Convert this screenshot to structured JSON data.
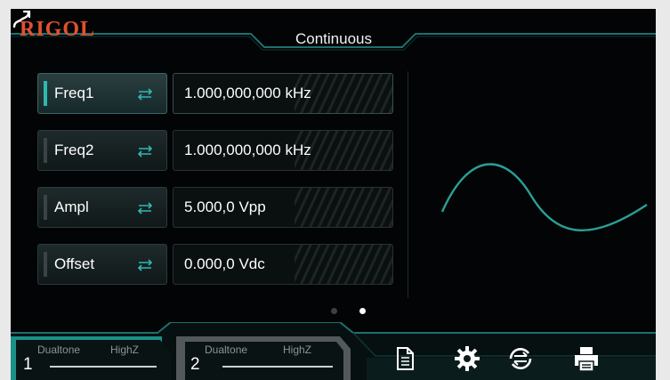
{
  "header": {
    "brand": "RIGOL",
    "mode": "Continuous",
    "status_icon": "network-link-icon"
  },
  "params": [
    {
      "label": "Freq1",
      "value": "1.000,000,000 kHz",
      "active": true
    },
    {
      "label": "Freq2",
      "value": "1.000,000,000 kHz",
      "active": false
    },
    {
      "label": "Ampl",
      "value": "5.000,0 Vpp",
      "active": false
    },
    {
      "label": "Offset",
      "value": "0.000,0 Vdc",
      "active": false
    }
  ],
  "pager": {
    "pages": 2,
    "current": 2
  },
  "channels": [
    {
      "number": "1",
      "mode": "Dualtone",
      "load": "HighZ"
    },
    {
      "number": "2",
      "mode": "Dualtone",
      "load": "HighZ"
    }
  ],
  "toolbar_icons": [
    "document-icon",
    "gear-icon",
    "sync-icon",
    "print-icon"
  ],
  "colors": {
    "brand": "#e0522c",
    "accent": "#2fb8b0",
    "background": "#020405"
  }
}
